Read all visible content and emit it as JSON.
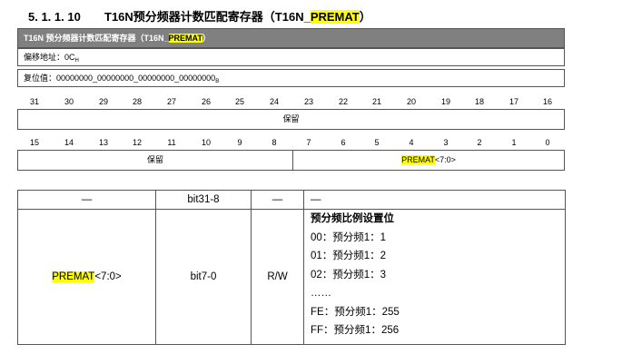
{
  "section": {
    "number": "5. 1. 1. 10",
    "title_prefix": "T16N预分频器计数匹配寄存器（T16N_",
    "title_hl": "PREMAT",
    "title_suffix": "）"
  },
  "register_bar": {
    "prefix": "T16N 预分频器计数匹配寄存器（T16N_",
    "hl": "PREMAT",
    "suffix": "）"
  },
  "offset": {
    "label": "偏移地址：0C",
    "subscript": "H"
  },
  "reset": {
    "label": "复位值：00000000_00000000_00000000_00000000",
    "subscript": "B"
  },
  "bits_high": [
    "31",
    "30",
    "29",
    "28",
    "27",
    "26",
    "25",
    "24",
    "23",
    "22",
    "21",
    "20",
    "19",
    "18",
    "17",
    "16"
  ],
  "bits_low": [
    "15",
    "14",
    "13",
    "12",
    "11",
    "10",
    "9",
    "8",
    "7",
    "6",
    "5",
    "4",
    "3",
    "2",
    "1",
    "0"
  ],
  "field_high": {
    "label": "保留"
  },
  "field_low": {
    "left": "保留",
    "right_hl": "PREMAT",
    "right_rest": "<7:0>"
  },
  "table": {
    "header": [
      "—",
      "bit31-8",
      "—",
      "—"
    ],
    "row": {
      "name_hl": "PREMAT",
      "name_rest": "<7:0>",
      "bits": "bit7-0",
      "access": "R/W",
      "desc_title": "预分频比例设置位",
      "desc_lines": [
        "00：预分频1：1",
        "01：预分频1：2",
        "02：预分频1：3",
        "……",
        "FE：预分频1：255",
        "FF：预分频1：256"
      ]
    }
  }
}
